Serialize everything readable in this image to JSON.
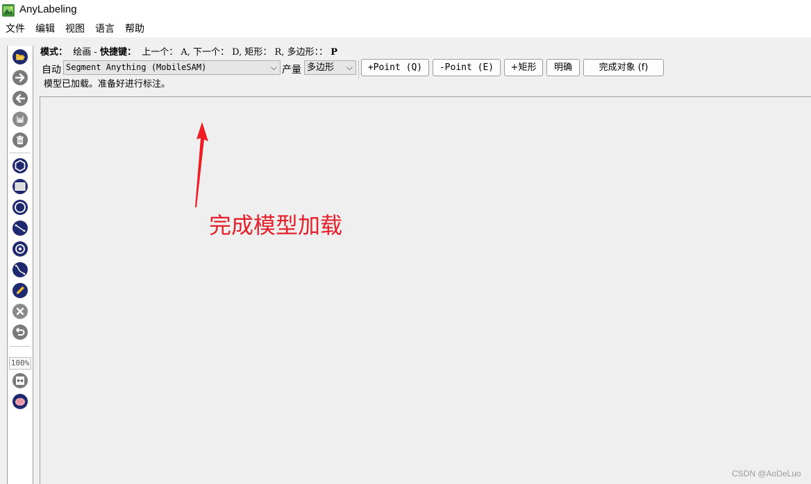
{
  "window": {
    "title": "AnyLabeling"
  },
  "menu": [
    "文件",
    "编辑",
    "视图",
    "语言",
    "帮助"
  ],
  "toolbar": {
    "icons": [
      "open-folder-icon",
      "next-image-icon",
      "previous-image-icon",
      "save-icon",
      "delete-icon",
      "polygon-icon",
      "rectangle-icon",
      "circle-icon",
      "line-icon",
      "point-icon",
      "linestrip-icon",
      "edit-pencil-icon",
      "close-icon",
      "undo-icon",
      "fit-width-icon",
      "brain-ai-icon"
    ],
    "zoom": "100%"
  },
  "mode_line": {
    "mode_label": "模式：",
    "mode_value": "绘画 - ",
    "shortcut_label": "快捷键：",
    "shortcuts": "上一个： A, 下一个： D, 矩形： R, 多边形：：",
    "last_key": "P"
  },
  "auto": {
    "label": "自动",
    "model_value": "Segment Anything (MobileSAM)",
    "output_label": "产量",
    "output_value": "多边形",
    "buttons": [
      "+Point (Q)",
      "-Point (E)",
      "+矩形",
      "明确",
      "完成对象 (f)"
    ]
  },
  "status": "模型已加载。准备好进行标注。",
  "annotation": {
    "text": "完成模型加载",
    "color": "#e5202a"
  },
  "watermark": "CSDN @AoDeLuo",
  "colors": {
    "tool_blue": "#1f2a6e",
    "tool_gray": "#7a7a7a",
    "folder_yellow": "#f3b92b"
  }
}
